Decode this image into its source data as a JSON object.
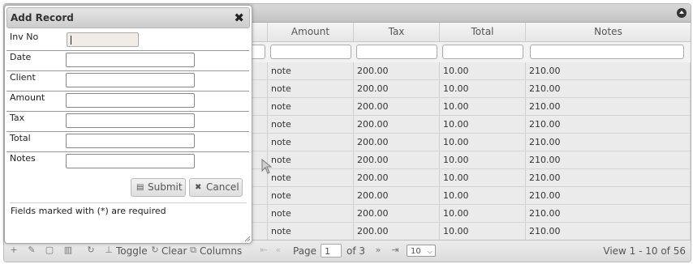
{
  "dialog": {
    "title": "Add Record",
    "close_glyph": "✖",
    "fields": [
      {
        "label": "Inv No",
        "value": "",
        "readonly": true
      },
      {
        "label": "Date",
        "value": ""
      },
      {
        "label": "Client",
        "value": ""
      },
      {
        "label": "Amount",
        "value": ""
      },
      {
        "label": "Tax",
        "value": ""
      },
      {
        "label": "Total",
        "value": ""
      },
      {
        "label": "Notes",
        "value": ""
      }
    ],
    "submit_label": "Submit",
    "cancel_label": "Cancel",
    "required_note": "Fields marked with (*) are required"
  },
  "grid": {
    "columns": [
      "Amount",
      "Tax",
      "Total",
      "Notes"
    ],
    "rows": [
      [
        "note",
        "200.00",
        "10.00",
        "210.00"
      ],
      [
        "note",
        "200.00",
        "10.00",
        "210.00"
      ],
      [
        "note",
        "200.00",
        "10.00",
        "210.00"
      ],
      [
        "note",
        "200.00",
        "10.00",
        "210.00"
      ],
      [
        "note",
        "200.00",
        "10.00",
        "210.00"
      ],
      [
        "note",
        "200.00",
        "10.00",
        "210.00"
      ],
      [
        "note",
        "200.00",
        "10.00",
        "210.00"
      ],
      [
        "note",
        "200.00",
        "10.00",
        "210.00"
      ],
      [
        "note",
        "200.00",
        "10.00",
        "210.00"
      ],
      [
        "note",
        "200.00",
        "10.00",
        "210.00"
      ]
    ]
  },
  "pager": {
    "toggle_label": "Toggle",
    "clear_label": "Clear",
    "columns_label": "Columns",
    "page_label": "Page",
    "page_value": "1",
    "of_label": "of 3",
    "rows_per_page": "10",
    "view_info": "View 1 - 10 of 56"
  }
}
